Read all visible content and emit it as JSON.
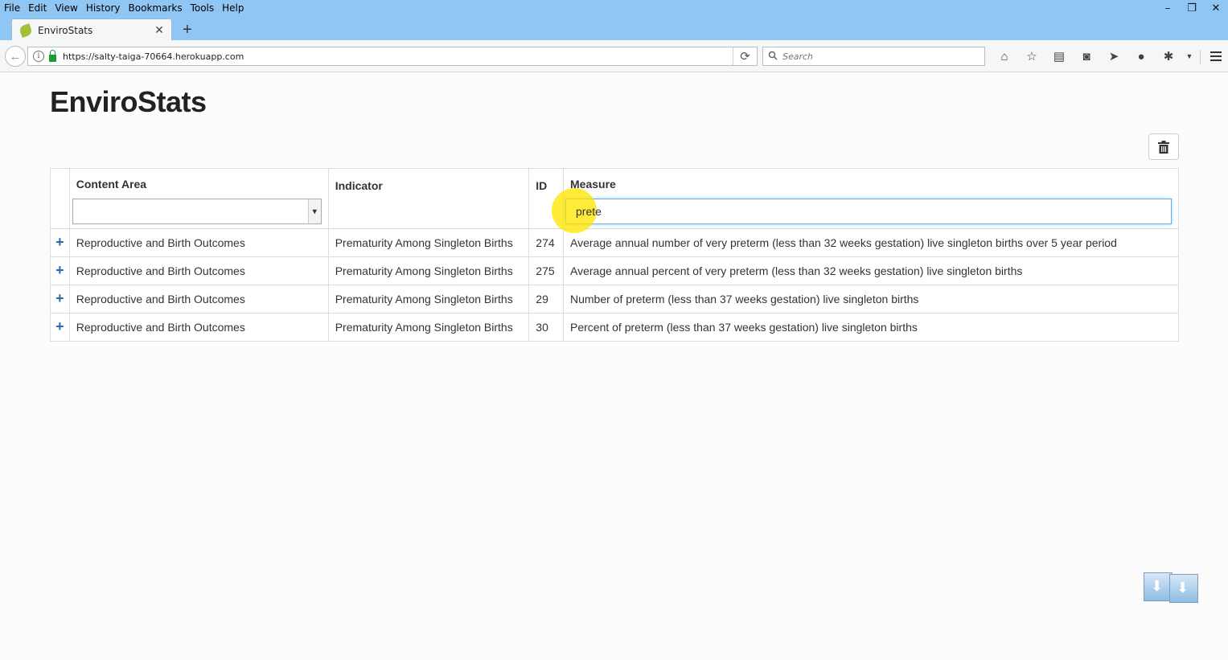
{
  "browser": {
    "menu": [
      "File",
      "Edit",
      "View",
      "History",
      "Bookmarks",
      "Tools",
      "Help"
    ],
    "tab_title": "EnviroStats",
    "url": "https://salty-taiga-70664.herokuapp.com",
    "search_placeholder": "Search",
    "window_controls": {
      "minimize": "–",
      "restore": "❐",
      "close": "✕"
    }
  },
  "page": {
    "title": "EnviroStats"
  },
  "table": {
    "headers": {
      "content_area": "Content Area",
      "indicator": "Indicator",
      "id": "ID",
      "measure": "Measure"
    },
    "filters": {
      "content_area_selected": "",
      "measure_value": "prete"
    },
    "rows": [
      {
        "content_area": "Reproductive and Birth Outcomes",
        "indicator": "Prematurity Among Singleton Births",
        "id": "274",
        "measure": "Average annual number of very preterm (less than 32 weeks gestation) live singleton births over 5 year period"
      },
      {
        "content_area": "Reproductive and Birth Outcomes",
        "indicator": "Prematurity Among Singleton Births",
        "id": "275",
        "measure": "Average annual percent of very preterm (less than 32 weeks gestation) live singleton births"
      },
      {
        "content_area": "Reproductive and Birth Outcomes",
        "indicator": "Prematurity Among Singleton Births",
        "id": "29",
        "measure": "Number of preterm (less than 37 weeks gestation) live singleton births"
      },
      {
        "content_area": "Reproductive and Birth Outcomes",
        "indicator": "Prematurity Among Singleton Births",
        "id": "30",
        "measure": "Percent of preterm (less than 37 weeks gestation) live singleton births"
      }
    ]
  },
  "colors": {
    "titlebar": "#8fc6f3",
    "expand_icon": "#2a6bb0",
    "focus_border": "#66afe9",
    "cursor_highlight": "#ffe600"
  }
}
